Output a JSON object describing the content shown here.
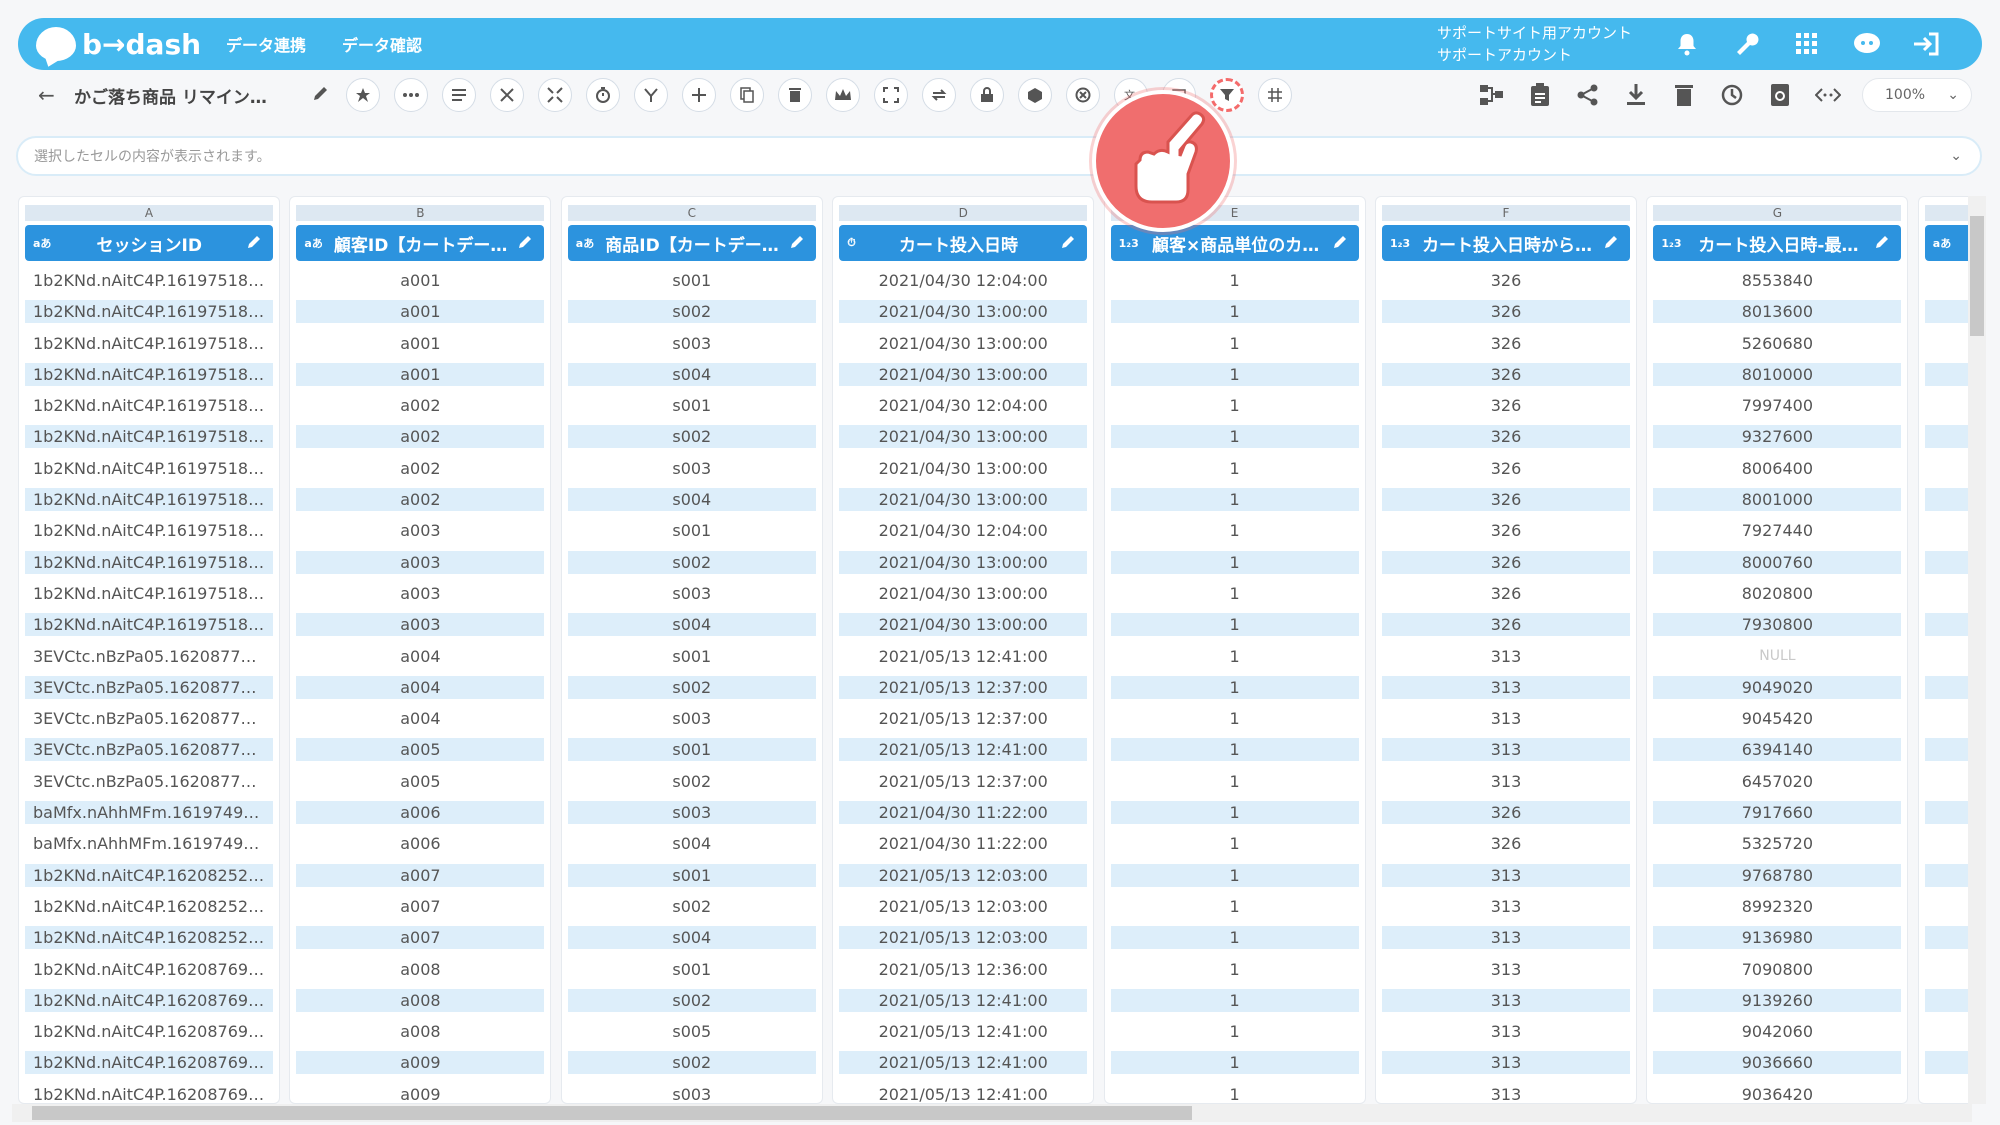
{
  "app": {
    "logo": "b→dash"
  },
  "topnav": [
    "データ連携",
    "データ確認"
  ],
  "account": {
    "line1": "サポートサイト用アカウント",
    "line2": "サポートアカウント"
  },
  "toolbar": {
    "title": "かご落ち商品 リマイン…",
    "zoom": "100%"
  },
  "cellbar": {
    "placeholder": "選択したセルの内容が表示されます。"
  },
  "columns": [
    {
      "letter": "A",
      "type": "aあ",
      "name": "セッションID"
    },
    {
      "letter": "B",
      "type": "aあ",
      "name": "顧客ID【カートデー…"
    },
    {
      "letter": "C",
      "type": "aあ",
      "name": "商品ID【カートデー…"
    },
    {
      "letter": "D",
      "type": "⏱",
      "name": "カート投入日時"
    },
    {
      "letter": "E",
      "type": "1₂3",
      "name": "顧客×商品単位のカ…"
    },
    {
      "letter": "F",
      "type": "1₂3",
      "name": "カート投入日時から…"
    },
    {
      "letter": "G",
      "type": "1₂3",
      "name": "カート投入日時-最…"
    },
    {
      "letter": "",
      "type": "aあ",
      "name": ""
    }
  ],
  "rows": [
    [
      "1b2KNd.nAitC4P.161975180…",
      "a001",
      "s001",
      "2021/04/30 12:04:00",
      "1",
      "326",
      "8553840"
    ],
    [
      "1b2KNd.nAitC4P.161975180…",
      "a001",
      "s002",
      "2021/04/30 13:00:00",
      "1",
      "326",
      "8013600"
    ],
    [
      "1b2KNd.nAitC4P.161975180…",
      "a001",
      "s003",
      "2021/04/30 13:00:00",
      "1",
      "326",
      "5260680"
    ],
    [
      "1b2KNd.nAitC4P.161975180…",
      "a001",
      "s004",
      "2021/04/30 13:00:00",
      "1",
      "326",
      "8010000"
    ],
    [
      "1b2KNd.nAitC4P.161975180…",
      "a002",
      "s001",
      "2021/04/30 12:04:00",
      "1",
      "326",
      "7997400"
    ],
    [
      "1b2KNd.nAitC4P.161975180…",
      "a002",
      "s002",
      "2021/04/30 13:00:00",
      "1",
      "326",
      "9327600"
    ],
    [
      "1b2KNd.nAitC4P.161975180…",
      "a002",
      "s003",
      "2021/04/30 13:00:00",
      "1",
      "326",
      "8006400"
    ],
    [
      "1b2KNd.nAitC4P.161975180…",
      "a002",
      "s004",
      "2021/04/30 13:00:00",
      "1",
      "326",
      "8001000"
    ],
    [
      "1b2KNd.nAitC4P.161975180…",
      "a003",
      "s001",
      "2021/04/30 12:04:00",
      "1",
      "326",
      "7927440"
    ],
    [
      "1b2KNd.nAitC4P.161975180…",
      "a003",
      "s002",
      "2021/04/30 13:00:00",
      "1",
      "326",
      "8000760"
    ],
    [
      "1b2KNd.nAitC4P.161975180…",
      "a003",
      "s003",
      "2021/04/30 13:00:00",
      "1",
      "326",
      "8020800"
    ],
    [
      "1b2KNd.nAitC4P.161975180…",
      "a003",
      "s004",
      "2021/04/30 13:00:00",
      "1",
      "326",
      "7930800"
    ],
    [
      "3EVCtc.nBzPa05.162087702…",
      "a004",
      "s001",
      "2021/05/13 12:41:00",
      "1",
      "313",
      "NULL"
    ],
    [
      "3EVCtc.nBzPa05.162087702…",
      "a004",
      "s002",
      "2021/05/13 12:37:00",
      "1",
      "313",
      "9049020"
    ],
    [
      "3EVCtc.nBzPa05.162087702…",
      "a004",
      "s003",
      "2021/05/13 12:37:00",
      "1",
      "313",
      "9045420"
    ],
    [
      "3EVCtc.nBzPa05.162087702…",
      "a005",
      "s001",
      "2021/05/13 12:41:00",
      "1",
      "313",
      "6394140"
    ],
    [
      "3EVCtc.nBzPa05.162087702…",
      "a005",
      "s002",
      "2021/05/13 12:37:00",
      "1",
      "313",
      "6457020"
    ],
    [
      "baMfx.nAhhMFm.161974929…",
      "a006",
      "s003",
      "2021/04/30 11:22:00",
      "1",
      "326",
      "7917660"
    ],
    [
      "baMfx.nAhhMFm.161974929…",
      "a006",
      "s004",
      "2021/04/30 11:22:00",
      "1",
      "326",
      "5325720"
    ],
    [
      "1b2KNd.nAitC4P.162082526…",
      "a007",
      "s001",
      "2021/05/13 12:03:00",
      "1",
      "313",
      "9768780"
    ],
    [
      "1b2KNd.nAitC4P.162082526…",
      "a007",
      "s002",
      "2021/05/13 12:03:00",
      "1",
      "313",
      "8992320"
    ],
    [
      "1b2KNd.nAitC4P.162082526…",
      "a007",
      "s004",
      "2021/05/13 12:03:00",
      "1",
      "313",
      "9136980"
    ],
    [
      "1b2KNd.nAitC4P.162087690…",
      "a008",
      "s001",
      "2021/05/13 12:36:00",
      "1",
      "313",
      "7090800"
    ],
    [
      "1b2KNd.nAitC4P.162087690…",
      "a008",
      "s002",
      "2021/05/13 12:41:00",
      "1",
      "313",
      "9139260"
    ],
    [
      "1b2KNd.nAitC4P.162087690…",
      "a008",
      "s005",
      "2021/05/13 12:41:00",
      "1",
      "313",
      "9042060"
    ],
    [
      "1b2KNd.nAitC4P.162087690…",
      "a009",
      "s002",
      "2021/05/13 12:41:00",
      "1",
      "313",
      "9036660"
    ],
    [
      "1b2KNd.nAitC4P.162087690…",
      "a009",
      "s003",
      "2021/05/13 12:41:00",
      "1",
      "313",
      "9036420"
    ]
  ],
  "toolbar_icons": [
    "star-icon",
    "ellipsis-icon",
    "list-icon",
    "scissors-icon",
    "split-icon",
    "timer-icon",
    "merge-icon",
    "plus-icon",
    "copy-icon",
    "trash-icon",
    "crown-icon",
    "expand-icon",
    "repeat-icon",
    "lock-icon",
    "box-icon",
    "cancel-icon",
    "translate-icon",
    "calendar-icon",
    "filter-icon",
    "grid-icon"
  ],
  "colors": {
    "header_blue": "#45b9ee",
    "column_head": "#2c93de",
    "row_alt": "#ddeefa",
    "highlight": "#f46b6b"
  }
}
